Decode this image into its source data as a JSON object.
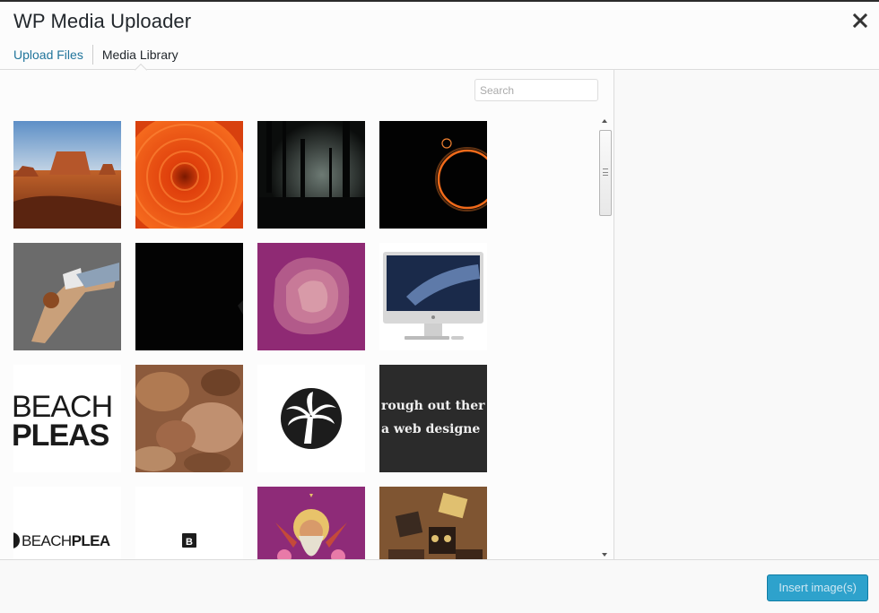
{
  "modal": {
    "title": "WP Media Uploader"
  },
  "tabs": [
    {
      "label": "Upload Files",
      "active": false
    },
    {
      "label": "Media Library",
      "active": true
    }
  ],
  "search": {
    "placeholder": "Search",
    "value": ""
  },
  "grid": {
    "items": [
      {
        "name": "desert-mesa-image"
      },
      {
        "name": "orange-dahlia-image"
      },
      {
        "name": "dark-forest-image"
      },
      {
        "name": "eclipse-ring-image"
      },
      {
        "name": "breakdancer-image"
      },
      {
        "name": "black-image"
      },
      {
        "name": "pink-blob-image"
      },
      {
        "name": "imac-image"
      },
      {
        "name": "beach-please-logo-image",
        "text_line1": "BEACH",
        "text_line2": "PLEAS"
      },
      {
        "name": "brown-blur-image"
      },
      {
        "name": "palm-tree-logo-image"
      },
      {
        "name": "web-designer-text-image",
        "text_line1": "rough out ther",
        "text_line2": "a web designe"
      },
      {
        "name": "beach-please-wordmark-image",
        "text_light": "BEACH",
        "text_bold": "PLEA"
      },
      {
        "name": "b-icon-image",
        "text": "B"
      },
      {
        "name": "bearded-warrior-illustration-image"
      },
      {
        "name": "robots-illustration-image"
      }
    ]
  },
  "footer": {
    "insert_label": "Insert image(s)"
  },
  "colors": {
    "link": "#21759b",
    "button": "#2ea2cc"
  }
}
